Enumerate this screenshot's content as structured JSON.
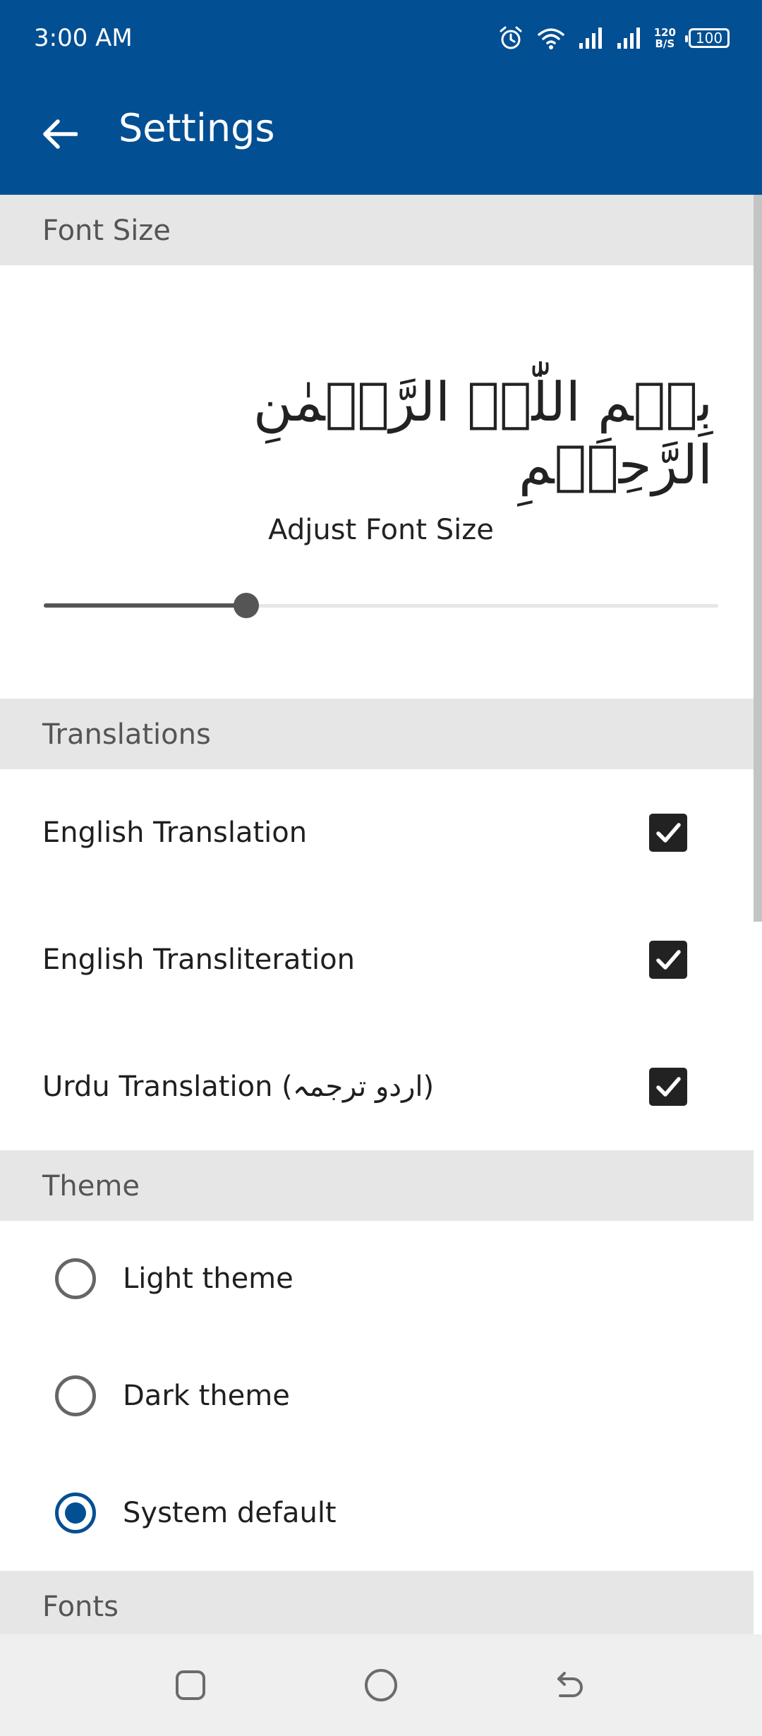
{
  "status_bar": {
    "time": "3:00 AM",
    "speed_top": "120",
    "speed_bottom": "B/S",
    "battery": "100"
  },
  "app_bar": {
    "title": "Settings"
  },
  "sections": {
    "font_size": "Font Size",
    "translations": "Translations",
    "theme": "Theme",
    "fonts": "Fonts"
  },
  "font_size": {
    "sample_text": "بِسۡمِ اللّٰہِ الرَّحۡمٰنِ الرَّحِیۡمِ",
    "adjust_label": "Adjust Font Size",
    "slider_value": 0.3
  },
  "translations": [
    {
      "label": "English Translation",
      "checked": true
    },
    {
      "label": "English Transliteration",
      "checked": true
    },
    {
      "label": "Urdu Translation (اردو ترجمہ)",
      "checked": true
    }
  ],
  "theme": {
    "options": [
      {
        "label": "Light theme",
        "selected": false
      },
      {
        "label": "Dark theme",
        "selected": false
      },
      {
        "label": "System default",
        "selected": true
      }
    ]
  },
  "colors": {
    "primary": "#034f93",
    "section_bg": "#e6e6e6",
    "navbar_bg": "#efefef"
  },
  "icons": {
    "back": "arrow-left-icon",
    "alarm": "alarm-icon",
    "wifi": "wifi-icon",
    "signal": "signal-icon",
    "battery": "battery-icon",
    "nav_recents": "square-icon",
    "nav_home": "circle-icon",
    "nav_back": "back-arrow-icon"
  }
}
